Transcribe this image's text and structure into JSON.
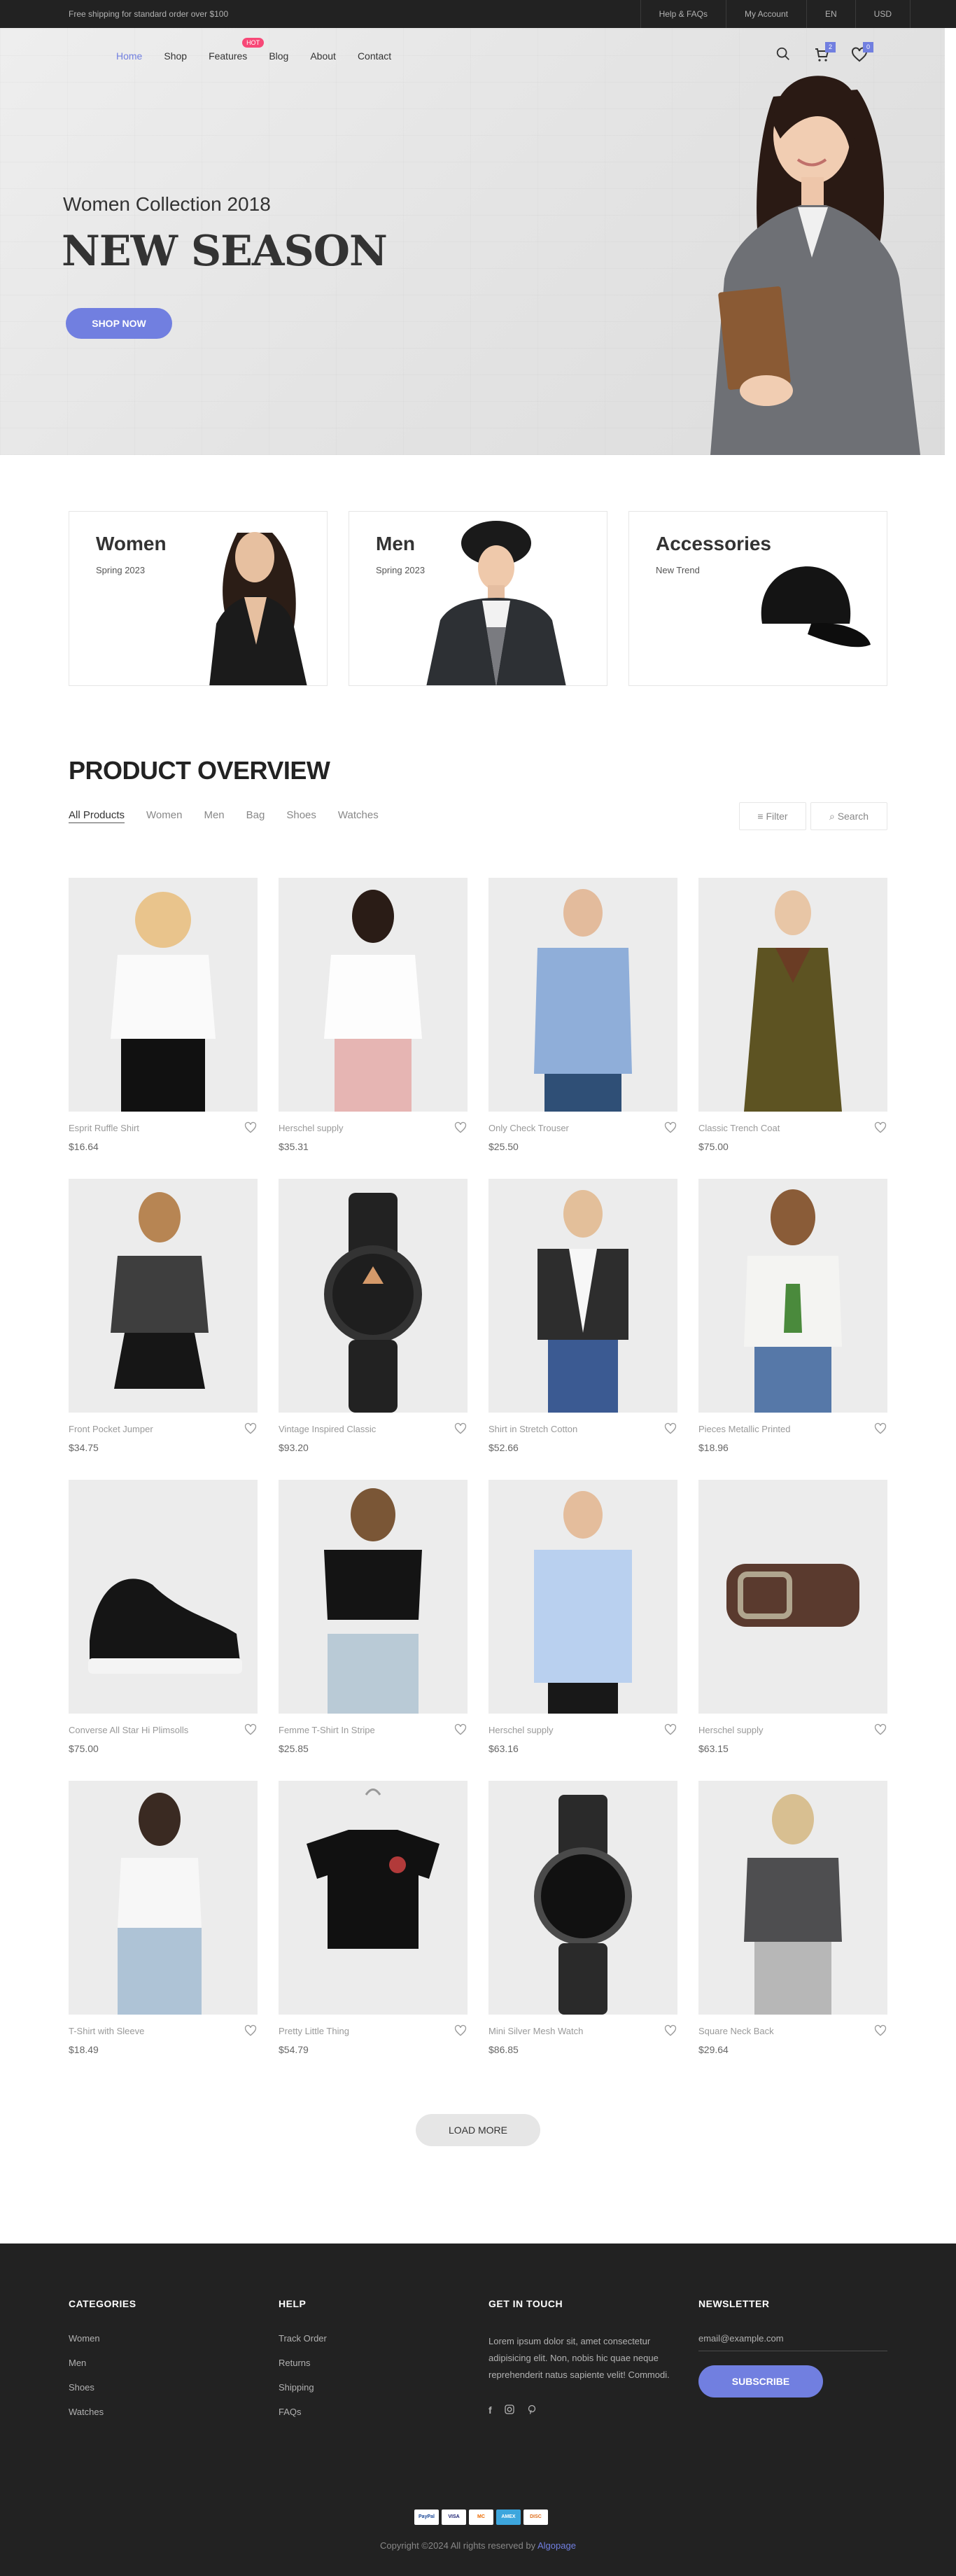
{
  "topbar": {
    "shipping": "Free shipping for standard order over $100",
    "links": [
      "Help & FAQs",
      "My Account",
      "EN",
      "USD"
    ]
  },
  "nav": {
    "items": [
      "Home",
      "Shop",
      "Features",
      "Blog",
      "About",
      "Contact"
    ],
    "active": "Home",
    "badge": "HOT",
    "cart_count": "2",
    "wishlist_count": "0"
  },
  "hero": {
    "subtitle": "Women Collection 2018",
    "title": "NEW SEASON",
    "button": "SHOP NOW"
  },
  "categories": [
    {
      "name": "Women",
      "sub": "Spring 2023"
    },
    {
      "name": "Men",
      "sub": "Spring 2023"
    },
    {
      "name": "Accessories",
      "sub": "New Trend"
    }
  ],
  "overview": {
    "title": "PRODUCT OVERVIEW",
    "filters": [
      "All Products",
      "Women",
      "Men",
      "Bag",
      "Shoes",
      "Watches"
    ],
    "filter_button": "Filter",
    "search_button": "Search"
  },
  "products": [
    {
      "name": "Esprit Ruffle Shirt",
      "price": "$16.64"
    },
    {
      "name": "Herschel supply",
      "price": "$35.31"
    },
    {
      "name": "Only Check Trouser",
      "price": "$25.50"
    },
    {
      "name": "Classic Trench Coat",
      "price": "$75.00"
    },
    {
      "name": "Front Pocket Jumper",
      "price": "$34.75"
    },
    {
      "name": "Vintage Inspired Classic",
      "price": "$93.20"
    },
    {
      "name": "Shirt in Stretch Cotton",
      "price": "$52.66"
    },
    {
      "name": "Pieces Metallic Printed",
      "price": "$18.96"
    },
    {
      "name": "Converse All Star Hi Plimsolls",
      "price": "$75.00"
    },
    {
      "name": "Femme T-Shirt In Stripe",
      "price": "$25.85"
    },
    {
      "name": "Herschel supply",
      "price": "$63.16"
    },
    {
      "name": "Herschel supply",
      "price": "$63.15"
    },
    {
      "name": "T-Shirt with Sleeve",
      "price": "$18.49"
    },
    {
      "name": "Pretty Little Thing",
      "price": "$54.79"
    },
    {
      "name": "Mini Silver Mesh Watch",
      "price": "$86.85"
    },
    {
      "name": "Square Neck Back",
      "price": "$29.64"
    }
  ],
  "load_more": "LOAD MORE",
  "footer": {
    "categories_title": "CATEGORIES",
    "categories": [
      "Women",
      "Men",
      "Shoes",
      "Watches"
    ],
    "help_title": "HELP",
    "help": [
      "Track Order",
      "Returns",
      "Shipping",
      "FAQs"
    ],
    "contact_title": "GET IN TOUCH",
    "contact_text": "Lorem ipsum dolor sit, amet consectetur adipisicing elit. Non, nobis hic quae neque reprehenderit natus sapiente velit! Commodi.",
    "newsletter_title": "NEWSLETTER",
    "newsletter_placeholder": "email@example.com",
    "subscribe": "SUBSCRIBE",
    "payments": [
      "PayPal",
      "VISA",
      "MC",
      "AMEX",
      "DISC"
    ],
    "copyright": "Copyright ©2024 All rights reserved by",
    "brand": "Algopage"
  },
  "colors": {
    "accent": "#717fe0",
    "dark": "#222222",
    "badge": "#f74877"
  }
}
